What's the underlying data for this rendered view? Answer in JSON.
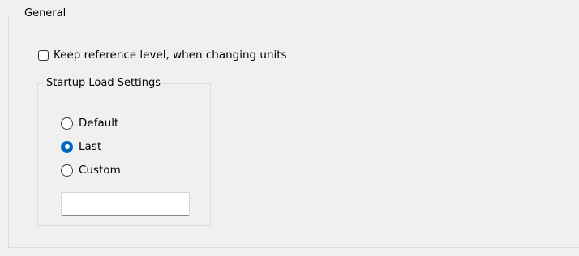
{
  "general": {
    "title": "General",
    "keep_reference_checkbox": {
      "label": "Keep reference level, when changing units",
      "checked": false
    },
    "startup_load_settings": {
      "title": "Startup Load Settings",
      "options": [
        {
          "label": "Default",
          "selected": false
        },
        {
          "label": "Last",
          "selected": true
        },
        {
          "label": "Custom",
          "selected": false
        }
      ],
      "custom_path": {
        "value": "",
        "placeholder": ""
      }
    }
  },
  "colors": {
    "window_background": "#f0f0f0",
    "group_border": "#dcdcdc",
    "radio_selected_accent": "#0067c0"
  }
}
